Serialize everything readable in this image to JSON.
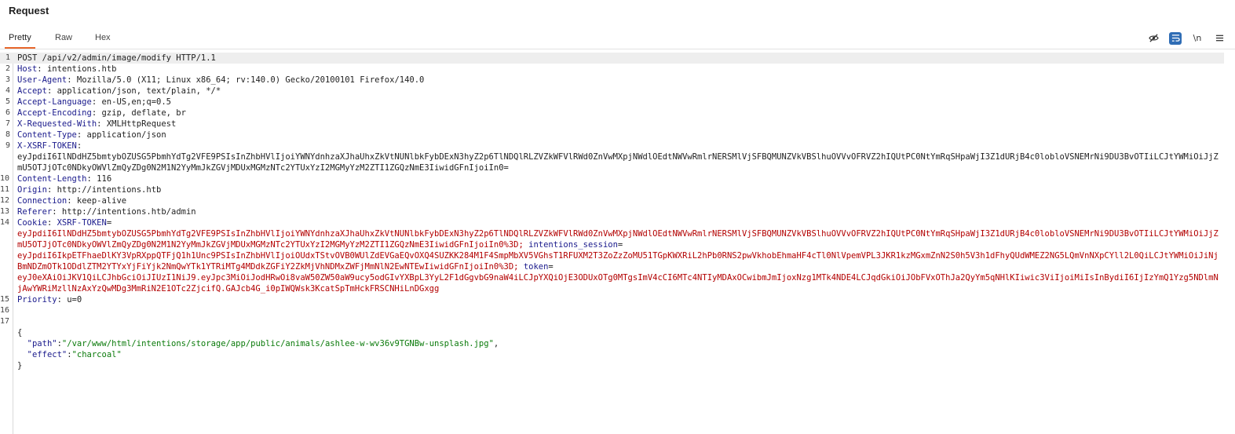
{
  "panel": {
    "title": "Request"
  },
  "tabs": {
    "pretty": "Pretty",
    "raw": "Raw",
    "hex": "Hex"
  },
  "toolbar": {
    "hide_icon": "eye-off-icon",
    "wrap_icon": "word-wrap-icon",
    "newline_label": "\\n",
    "menu_icon": "hamburger-menu-icon"
  },
  "request": {
    "request_line": "POST /api/v2/admin/image/modify HTTP/1.1",
    "host": {
      "name": "Host",
      "value": "intentions.htb"
    },
    "user_agent": {
      "name": "User-Agent",
      "value": "Mozilla/5.0 (X11; Linux x86_64; rv:140.0) Gecko/20100101 Firefox/140.0"
    },
    "accept": {
      "name": "Accept",
      "value": "application/json, text/plain, */*"
    },
    "accept_language": {
      "name": "Accept-Language",
      "value": "en-US,en;q=0.5"
    },
    "accept_encoding": {
      "name": "Accept-Encoding",
      "value": "gzip, deflate, br"
    },
    "x_requested_with": {
      "name": "X-Requested-With",
      "value": "XMLHttpRequest"
    },
    "content_type": {
      "name": "Content-Type",
      "value": "application/json"
    },
    "x_xsrf_token": {
      "name": "X-XSRF-TOKEN",
      "value": "eyJpdiI6IlNDdHZ5bmtybOZUSG5PbmhYdTg2VFE9PSIsInZhbHVlIjoiYWNYdnhzaXJhaUhxZkVtNUNlbkFybDExN3hyZ2p6TlNDQlRLZVZkWFVlRWd0ZnVwMXpjNWdlOEdtNWVwRmlrNERSMlVjSFBQMUNZVkVBSlhuOVVvOFRVZ2hIQUtPC0NtYmRqSHpaWjI3Z1dURjB4c0lobloVSNEMrNi9DU3BvOTIiLCJtYWMiOiJjZmU5OTJjOTc0NDkyOWVlZmQyZDg0N2M1N2YyMmJkZGVjMDUxMGMzNTc2YTUxYzI2MGMyYzM2ZTI1ZGQzNmE3IiwidGFnIjoiIn0="
    },
    "content_length": {
      "name": "Content-Length",
      "value": "116"
    },
    "origin": {
      "name": "Origin",
      "value": "http://intentions.htb"
    },
    "connection": {
      "name": "Connection",
      "value": "keep-alive"
    },
    "referer": {
      "name": "Referer",
      "value": "http://intentions.htb/admin"
    },
    "cookie": {
      "name": "Cookie",
      "xsrf_name": "XSRF-TOKEN",
      "xsrf_value": "eyJpdiI6IlNDdHZ5bmtybOZUSG5PbmhYdTg2VFE9PSIsInZhbHVlIjoiYWNYdnhzaXJhaUhxZkVtNUNlbkFybDExN3hyZ2p6TlNDQlRLZVZkWFVlRWd0ZnVwMXpjNWdlOEdtNWVwRmlrNERSMlVjSFBQMUNZVkVBSlhuOVVvOFRVZ2hIQUtPC0NtYmRqSHpaWjI3Z1dURjB4c0lobloVSNEMrNi9DU3BvOTIiLCJtYWMiOiJjZmU5OTJjOTc0NDkyOWVlZmQyZDg0N2M1N2YyMmJkZGVjMDUxMGMzNTc2YTUxYzI2MGMyYzM2ZTI1ZGQzNmE3IiwidGFnIjoiIn0%3D;",
      "session_name": "intentions_session",
      "session_value": "eyJpdiI6IkpETFhaeDlKY3VpRXppQTFjQ1h1Unc9PSIsInZhbHVlIjoiOUdxTStvOVB0WUlZdEVGaEQvOXQ4SUZKK284M1F4SmpMbXV5VGhsT1RFUXM2T3ZoZzZoMU51TGpKWXRiL2hPb0RNS2pwVkhobEhmaHF4cTl0NlVpemVPL3JKR1kzMGxmZnN2S0h5V3h1dFhyQUdWMEZ2NG5LQmVnNXpCYll2L0QiLCJtYWMiOiJiNjBmNDZmOTk1ODdlZTM2YTYxYjFiYjk2NmQwYTk1YTRiMTg4MDdkZGFiY2ZkMjVhNDMxZWFjMmNlN2EwNTEwIiwidGFnIjoiIn0%3D;",
      "token_name": "token",
      "token_value": "eyJ0eXAiOiJKV1QiLCJhbGciOiJIUzI1NiJ9.eyJpc3MiOiJodHRwOi8vaW50ZW50aW9ucy5odGIvYXBpL3YyL2F1dGgvbG9naW4iLCJpYXQiOjE3ODUxOTg0MTgsImV4cCI6MTc4NTIyMDAxOCwibmJmIjoxNzg1MTk4NDE4LCJqdGkiOiJObFVxOThJa2QyYm5qNHlKIiwic3ViIjoiMiIsInBydiI6IjIzYmQ1Yzg5NDlmNjAwYWRiMzllNzAxYzQwMDg3MmRiN2E1OTc2ZjcifQ.GAJcb4G_i0pIWQWsk3KcatSpTmHckFRSCNHiLnDGxgg"
    },
    "priority": {
      "name": "Priority",
      "value": "u=0"
    },
    "body": {
      "open": "{",
      "path_key": "\"path\"",
      "path_value": "\"/var/www/html/intentions/storage/app/public/animals/ashlee-w-wv36v9TGNBw-unsplash.jpg\"",
      "effect_key": "\"effect\"",
      "effect_value": "\"charcoal\"",
      "close": "}"
    }
  },
  "line_numbers": [
    "1",
    "2",
    "3",
    "4",
    "5",
    "6",
    "7",
    "8",
    "9",
    "10",
    "11",
    "12",
    "13",
    "14",
    "15",
    "16",
    "17"
  ]
}
